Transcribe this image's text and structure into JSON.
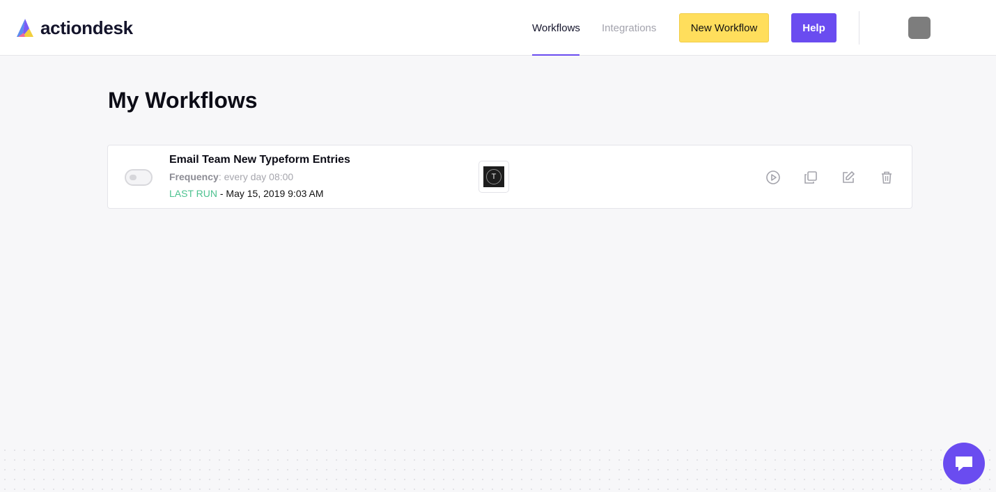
{
  "brand": {
    "name": "actiondesk"
  },
  "nav": {
    "tabs": [
      {
        "label": "Workflows",
        "active": true
      },
      {
        "label": "Integrations",
        "active": false
      }
    ],
    "new_workflow_label": "New Workflow",
    "help_label": "Help"
  },
  "page": {
    "title": "My Workflows"
  },
  "workflows": [
    {
      "name": "Email Team New Typeform Entries",
      "frequency_label": "Frequency",
      "frequency_value": ": every day 08:00",
      "last_run_label": "LAST RUN",
      "last_run_value": " - May 15, 2019 9:03 AM",
      "enabled": false,
      "integration_icon": "typeform-icon",
      "integration_letter": "T",
      "actions": [
        "play-icon",
        "duplicate-icon",
        "edit-icon",
        "trash-icon"
      ]
    }
  ],
  "colors": {
    "accent": "#6a4cf0",
    "new_workflow_bg": "#ffde5c",
    "last_run": "#4cc28f",
    "background": "#f7f7f9"
  }
}
